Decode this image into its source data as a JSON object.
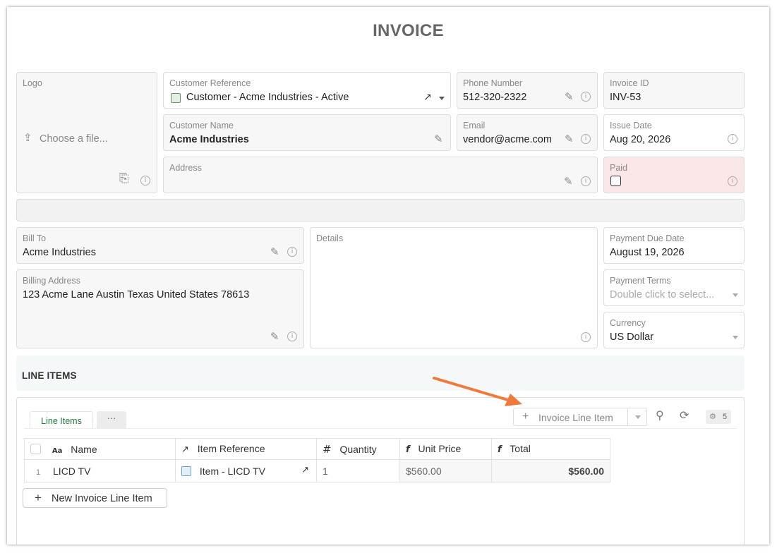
{
  "page_title": "INVOICE",
  "fields": {
    "logo": {
      "label": "Logo",
      "upload_text": "Choose a file..."
    },
    "customer_reference": {
      "label": "Customer Reference",
      "value": "Customer - Acme Industries - Active"
    },
    "phone_number": {
      "label": "Phone Number",
      "value": "512-320-2322"
    },
    "invoice_id": {
      "label": "Invoice ID",
      "value": "INV-53"
    },
    "customer_name": {
      "label": "Customer Name",
      "value": "Acme Industries"
    },
    "email": {
      "label": "Email",
      "value": "vendor@acme.com"
    },
    "issue_date": {
      "label": "Issue Date",
      "value": "Aug 20, 2026"
    },
    "address": {
      "label": "Address",
      "value": ""
    },
    "paid": {
      "label": "Paid",
      "checked": false
    },
    "bill_to": {
      "label": "Bill To",
      "value": "Acme Industries"
    },
    "details": {
      "label": "Details",
      "value": ""
    },
    "payment_due_date": {
      "label": "Payment Due Date",
      "value": "August 19, 2026"
    },
    "billing_address": {
      "label": "Billing Address",
      "value": "123 Acme Lane  Austin Texas United States 78613"
    },
    "payment_terms": {
      "label": "Payment Terms",
      "placeholder": "Double click to select..."
    },
    "currency": {
      "label": "Currency",
      "value": "US Dollar"
    }
  },
  "line_items_section": {
    "title": "LINE ITEMS",
    "tabs": [
      "Line Items",
      "···"
    ],
    "add_button_label": "Invoice Line Item",
    "field_count": "5",
    "new_button_label": "New Invoice Line Item",
    "columns": {
      "name": {
        "icon": "text-type-icon",
        "label": "Name"
      },
      "item_reference": {
        "icon": "link-arrow-icon",
        "label": "Item Reference"
      },
      "quantity": {
        "icon": "hash-icon",
        "label": "Quantity"
      },
      "unit_price": {
        "icon": "formula-icon",
        "label": "Unit Price"
      },
      "total": {
        "icon": "formula-icon",
        "label": "Total"
      }
    },
    "rows": [
      {
        "index": "1",
        "name": "LICD TV",
        "item_reference": "Item - LICD TV",
        "quantity": "1",
        "unit_price": "$560.00",
        "total": "$560.00"
      }
    ]
  },
  "colors": {
    "accent_green": "#1f7a3a",
    "paid_bg": "#fbe7e7",
    "arrow": "#f07a3c"
  }
}
